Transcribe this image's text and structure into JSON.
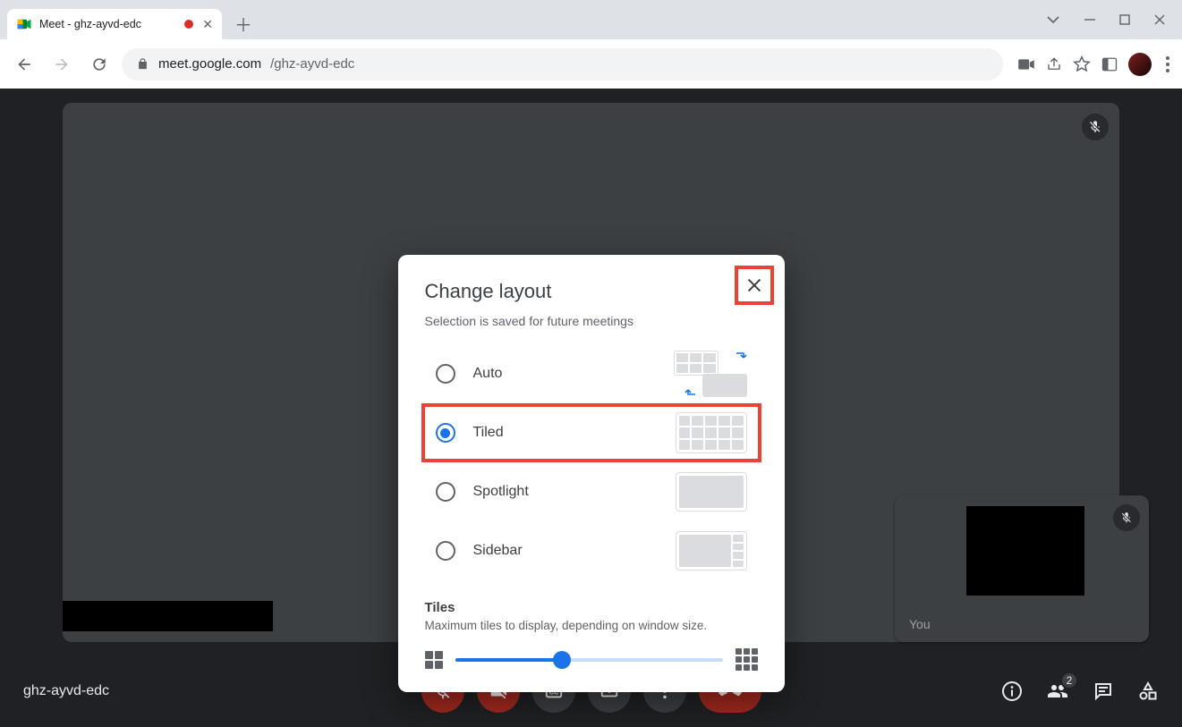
{
  "browser": {
    "tab_title": "Meet - ghz-ayvd-edc",
    "url_domain": "meet.google.com",
    "url_path": "/ghz-ayvd-edc"
  },
  "meet": {
    "meeting_code": "ghz-ayvd-edc",
    "self_label": "You",
    "participant_badge": "2"
  },
  "dialog": {
    "title": "Change layout",
    "subtitle": "Selection is saved for future meetings",
    "options": {
      "auto": "Auto",
      "tiled": "Tiled",
      "spotlight": "Spotlight",
      "sidebar": "Sidebar"
    },
    "selected": "tiled",
    "tiles_heading": "Tiles",
    "tiles_sub": "Maximum tiles to display, depending on window size.",
    "slider_value_percent": 40
  },
  "colors": {
    "accent": "#1a73e8",
    "highlight": "#ea4335",
    "danger": "#a52a1f"
  }
}
